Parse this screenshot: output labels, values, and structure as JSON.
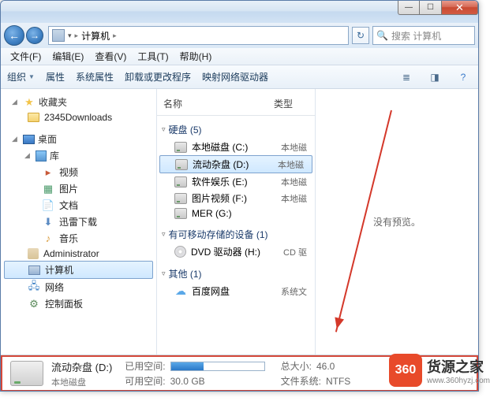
{
  "breadcrumb": {
    "location": "计算机"
  },
  "search": {
    "placeholder": "搜索 计算机"
  },
  "menu": {
    "file": "文件(F)",
    "edit": "编辑(E)",
    "view": "查看(V)",
    "tools": "工具(T)",
    "help": "帮助(H)"
  },
  "toolbar": {
    "organize": "组织",
    "properties": "属性",
    "sysprops": "系统属性",
    "uninstall": "卸载或更改程序",
    "mapdrive": "映射网络驱动器"
  },
  "nav": {
    "favorites": {
      "label": "收藏夹",
      "items": [
        {
          "label": "2345Downloads"
        }
      ]
    },
    "desktop": {
      "label": "桌面",
      "library": {
        "label": "库",
        "items": [
          {
            "label": "视频"
          },
          {
            "label": "图片"
          },
          {
            "label": "文档"
          },
          {
            "label": "迅雷下载"
          },
          {
            "label": "音乐"
          }
        ]
      },
      "items": [
        {
          "label": "Administrator"
        },
        {
          "label": "计算机"
        },
        {
          "label": "网络"
        },
        {
          "label": "控制面板"
        }
      ]
    }
  },
  "columns": {
    "name": "名称",
    "type": "类型"
  },
  "groups": {
    "hdd": {
      "label": "硬盘 (5)",
      "items": [
        {
          "label": "本地磁盘 (C:)",
          "type": "本地磁"
        },
        {
          "label": "流动杂盘 (D:)",
          "type": "本地磁",
          "selected": true
        },
        {
          "label": "软件娱乐 (E:)",
          "type": "本地磁"
        },
        {
          "label": "图片视频 (F:)",
          "type": "本地磁"
        },
        {
          "label": "MER (G:)",
          "type": ""
        }
      ]
    },
    "removable": {
      "label": "有可移动存储的设备 (1)",
      "items": [
        {
          "label": "DVD 驱动器 (H:)",
          "type": "CD 驱"
        }
      ]
    },
    "other": {
      "label": "其他 (1)",
      "items": [
        {
          "label": "百度网盘",
          "type": "系统文"
        }
      ]
    }
  },
  "preview": {
    "empty": "没有预览。"
  },
  "details": {
    "title": "流动杂盘 (D:)",
    "subtitle": "本地磁盘",
    "used_label": "已用空间:",
    "free_label": "可用空间:",
    "free_value": "30.0 GB",
    "total_label": "总大小:",
    "total_value": "46.0",
    "fs_label": "文件系统:",
    "fs_value": "NTFS"
  },
  "watermark": {
    "badge": "360",
    "title": "货源之家",
    "url": "www.360hyzj.com"
  }
}
